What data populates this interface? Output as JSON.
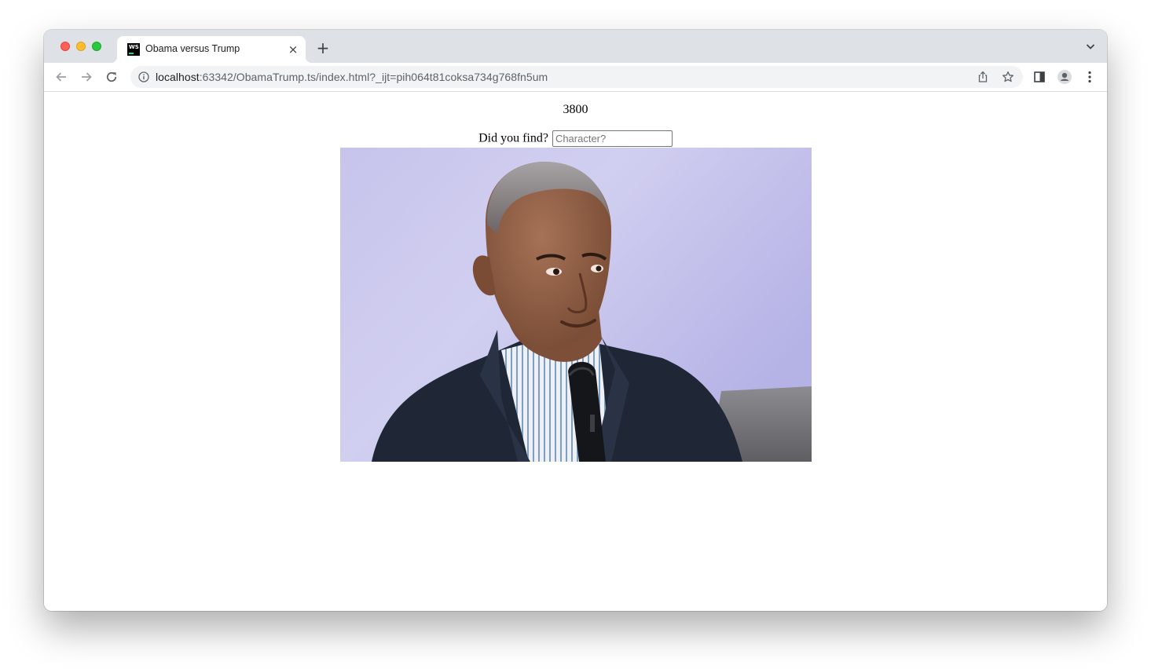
{
  "browser": {
    "tab": {
      "title": "Obama versus Trump",
      "favicon_label": "WS",
      "close_symbol": "×"
    },
    "new_tab_symbol": "+",
    "address": {
      "host": "localhost",
      "rest": ":63342/ObamaTrump.ts/index.html?_ijt=pih064t81coksa734g768fn5um"
    },
    "icons": [
      "back-arrow-icon",
      "forward-arrow-icon",
      "reload-icon",
      "site-info-icon",
      "share-icon",
      "bookmark-star-icon",
      "side-panel-icon",
      "profile-icon",
      "menu-kebab-icon",
      "tab-search-chevron-icon"
    ]
  },
  "page": {
    "score": "3800",
    "guess_label": "Did you find?",
    "guess_placeholder": "Character?",
    "guess_value": ""
  },
  "colors": {
    "tabstrip": "#dee1e6",
    "omnibox": "#f1f3f4",
    "photo_background": "#c9c6ee"
  }
}
